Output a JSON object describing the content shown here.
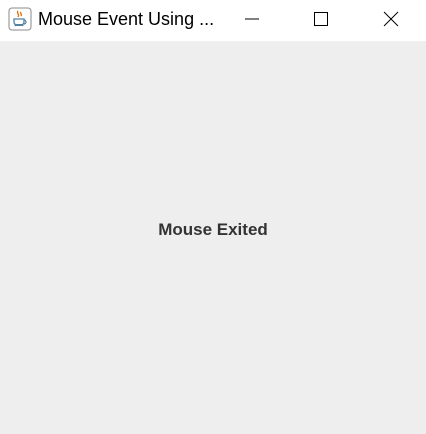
{
  "window": {
    "title": "Mouse Event Using ...",
    "icon": "java-coffee-cup-icon",
    "controls": {
      "minimize_icon": "minimize-icon",
      "maximize_icon": "maximize-icon",
      "close_icon": "close-icon"
    }
  },
  "content": {
    "status_text": "Mouse Exited",
    "background_color": "#eeeeee"
  }
}
